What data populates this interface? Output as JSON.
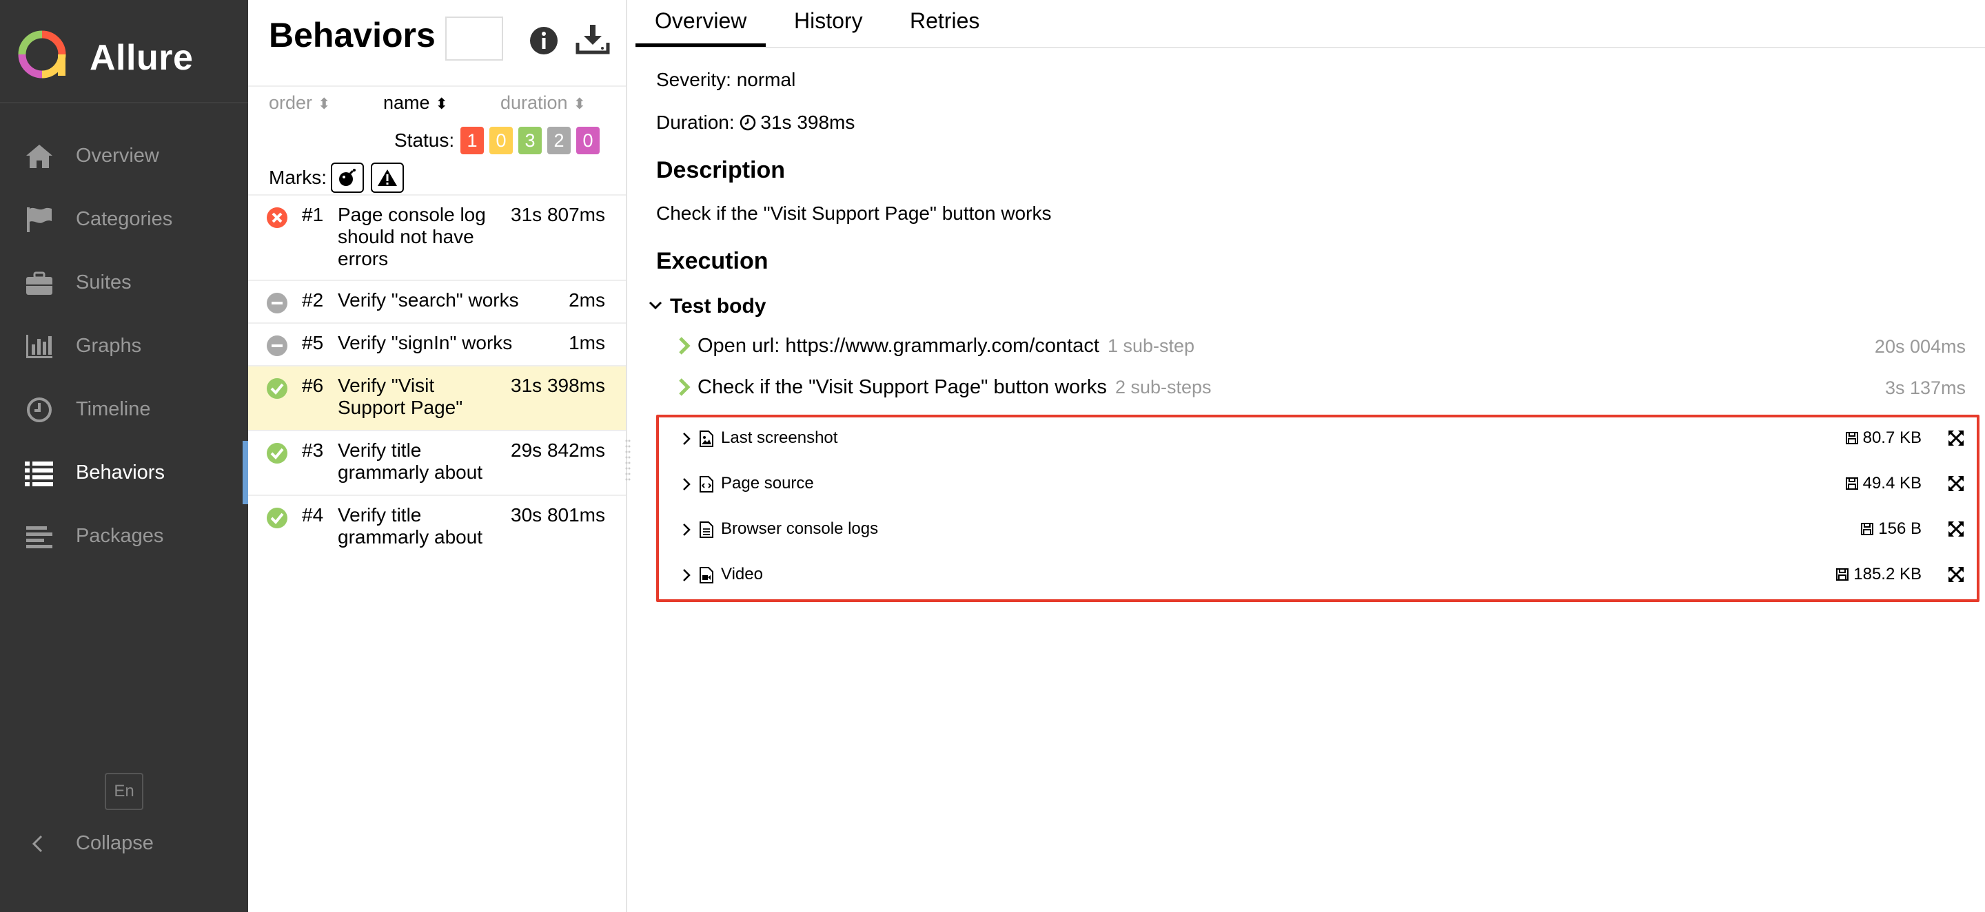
{
  "app": {
    "name": "Allure"
  },
  "sidebar": {
    "items": [
      {
        "label": "Overview",
        "icon": "home-icon",
        "active": false
      },
      {
        "label": "Categories",
        "icon": "flag-icon",
        "active": false
      },
      {
        "label": "Suites",
        "icon": "briefcase-icon",
        "active": false
      },
      {
        "label": "Graphs",
        "icon": "bar-chart-icon",
        "active": false
      },
      {
        "label": "Timeline",
        "icon": "clock-icon",
        "active": false
      },
      {
        "label": "Behaviors",
        "icon": "list-icon",
        "active": true
      },
      {
        "label": "Packages",
        "icon": "align-left-icon",
        "active": false
      }
    ],
    "language": "En",
    "collapse_label": "Collapse"
  },
  "list": {
    "title": "Behaviors",
    "sort": {
      "order": "order",
      "name": "name",
      "duration": "duration",
      "active": "name"
    },
    "status_label": "Status:",
    "status_counts": [
      {
        "value": "1",
        "status": "failed",
        "color": "#fd5a3e"
      },
      {
        "value": "0",
        "status": "broken",
        "color": "#ffd050"
      },
      {
        "value": "3",
        "status": "passed",
        "color": "#97cc64"
      },
      {
        "value": "2",
        "status": "skipped",
        "color": "#aaaaaa"
      },
      {
        "value": "0",
        "status": "unknown",
        "color": "#d35ebe"
      }
    ],
    "marks_label": "Marks:",
    "rows": [
      {
        "num": "#1",
        "name": "Page console log should not have errors",
        "duration": "31s 807ms",
        "status": "failed",
        "selected": false
      },
      {
        "num": "#2",
        "name": "Verify \"search\" works",
        "duration": "2ms",
        "status": "skipped",
        "selected": false
      },
      {
        "num": "#5",
        "name": "Verify \"signIn\" works",
        "duration": "1ms",
        "status": "skipped",
        "selected": false
      },
      {
        "num": "#6",
        "name": "Verify \"Visit Support Page\"",
        "duration": "31s 398ms",
        "status": "passed",
        "selected": true
      },
      {
        "num": "#3",
        "name": "Verify title grammarly about",
        "duration": "29s 842ms",
        "status": "passed",
        "selected": false
      },
      {
        "num": "#4",
        "name": "Verify title grammarly about",
        "duration": "30s 801ms",
        "status": "passed",
        "selected": false
      }
    ]
  },
  "detail": {
    "tabs": [
      "Overview",
      "History",
      "Retries"
    ],
    "active_tab": "Overview",
    "severity": "Severity: normal",
    "duration_label": "Duration:",
    "duration_value": "31s 398ms",
    "description_heading": "Description",
    "description": "Check if the \"Visit Support Page\" button works",
    "execution_heading": "Execution",
    "test_body": "Test body",
    "steps": [
      {
        "name": "Open url: https://www.grammarly.com/contact",
        "sub": "1 sub-step",
        "duration": "20s 004ms"
      },
      {
        "name": "Check if the \"Visit Support Page\" button works",
        "sub": "2 sub-steps",
        "duration": "3s 137ms"
      }
    ],
    "attachments": [
      {
        "name": "Last screenshot",
        "icon": "image-file-icon",
        "size": "80.7 KB"
      },
      {
        "name": "Page source",
        "icon": "code-file-icon",
        "size": "49.4 KB"
      },
      {
        "name": "Browser console logs",
        "icon": "text-file-icon",
        "size": "156 B"
      },
      {
        "name": "Video",
        "icon": "video-file-icon",
        "size": "185.2 KB"
      }
    ],
    "highlight_color": "#e63a2a"
  }
}
